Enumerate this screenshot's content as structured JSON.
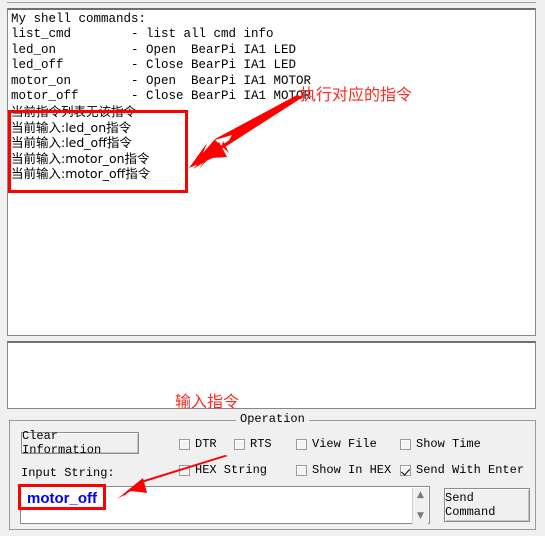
{
  "window": {
    "title_strip": ""
  },
  "terminal": {
    "lines": [
      {
        "text": "My shell commands:",
        "cjk": false
      },
      {
        "text": "list_cmd        - list all cmd info",
        "cjk": false
      },
      {
        "text": "led_on          - Open  BearPi IA1 LED",
        "cjk": false
      },
      {
        "text": "led_off         - Close BearPi IA1 LED",
        "cjk": false
      },
      {
        "text": "motor_on        - Open  BearPi IA1 MOTOR",
        "cjk": false
      },
      {
        "text": "motor_off       - Close BearPi IA1 MOTOR",
        "cjk": false
      },
      {
        "text": "当前指令列表无该指令",
        "cjk": true
      },
      {
        "text": "当前输入:led_on指令",
        "cjk": true
      },
      {
        "text": "当前输入:led_off指令",
        "cjk": true
      },
      {
        "text": "当前输入:motor_on指令",
        "cjk": true
      },
      {
        "text": "当前输入:motor_off指令",
        "cjk": true
      }
    ]
  },
  "secondary_output": {
    "value": ""
  },
  "operation": {
    "legend": "Operation",
    "clear_button_label": "Clear Information",
    "input_string_label": "Input String:",
    "send_button_label": "Send Command",
    "checkboxes": [
      {
        "label": "DTR",
        "checked": false
      },
      {
        "label": "RTS",
        "checked": false
      },
      {
        "label": "View File",
        "checked": false
      },
      {
        "label": "Show Time",
        "checked": false
      },
      {
        "label": "HEX String",
        "checked": false
      },
      {
        "label": "Show In HEX",
        "checked": false
      },
      {
        "label": "Send With Enter",
        "checked": true
      }
    ],
    "input_value": "motor_off",
    "input_placeholder": "",
    "spinner_up": "▲",
    "spinner_down": "▼"
  },
  "annotations": {
    "exec_label": "执行对应的指令",
    "input_label": "输入指令",
    "color": "#fe2a1f",
    "rect_color": "#fe0000"
  }
}
